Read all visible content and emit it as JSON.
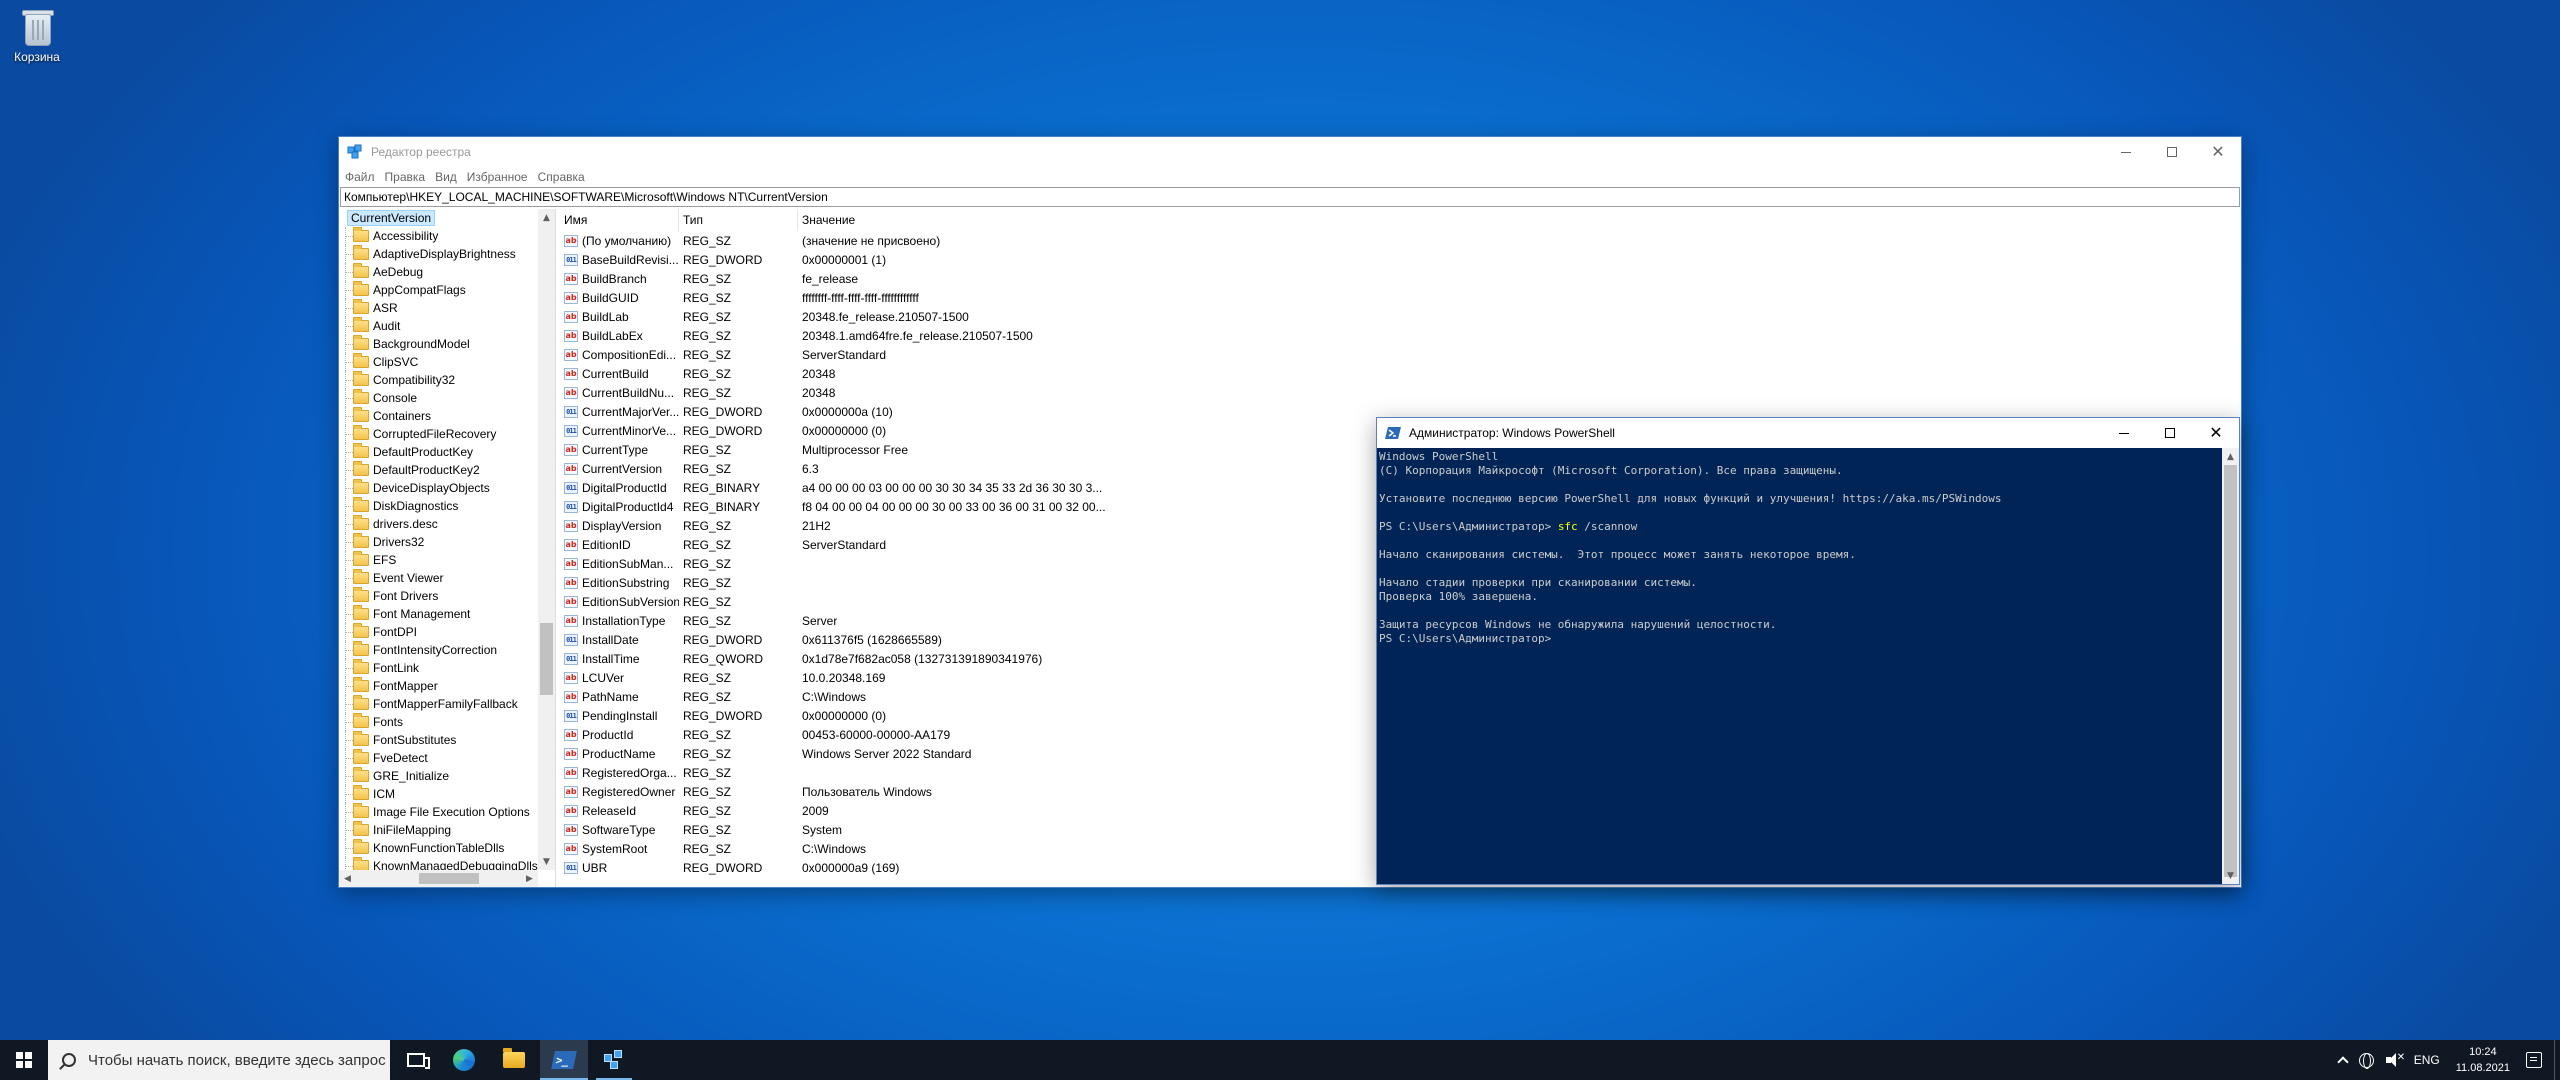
{
  "desktop": {
    "recycle_bin_label": "Корзина"
  },
  "regedit": {
    "title": "Редактор реестра",
    "menu": [
      "Файл",
      "Правка",
      "Вид",
      "Избранное",
      "Справка"
    ],
    "address": "Компьютер\\HKEY_LOCAL_MACHINE\\SOFTWARE\\Microsoft\\Windows NT\\CurrentVersion",
    "tree_selected": "CurrentVersion",
    "tree_items": [
      "Accessibility",
      "AdaptiveDisplayBrightness",
      "AeDebug",
      "AppCompatFlags",
      "ASR",
      "Audit",
      "BackgroundModel",
      "ClipSVC",
      "Compatibility32",
      "Console",
      "Containers",
      "CorruptedFileRecovery",
      "DefaultProductKey",
      "DefaultProductKey2",
      "DeviceDisplayObjects",
      "DiskDiagnostics",
      "drivers.desc",
      "Drivers32",
      "EFS",
      "Event Viewer",
      "Font Drivers",
      "Font Management",
      "FontDPI",
      "FontIntensityCorrection",
      "FontLink",
      "FontMapper",
      "FontMapperFamilyFallback",
      "Fonts",
      "FontSubstitutes",
      "FveDetect",
      "GRE_Initialize",
      "ICM",
      "Image File Execution Options",
      "IniFileMapping",
      "KnownFunctionTableDlls",
      "KnownManagedDebuggingDlls"
    ],
    "columns": {
      "name": "Имя",
      "type": "Тип",
      "value": "Значение"
    },
    "rows": [
      {
        "icon": "ab",
        "name": "(По умолчанию)",
        "type": "REG_SZ",
        "value": "(значение не присвоено)"
      },
      {
        "icon": "bin",
        "name": "BaseBuildRevisi...",
        "type": "REG_DWORD",
        "value": "0x00000001 (1)"
      },
      {
        "icon": "ab",
        "name": "BuildBranch",
        "type": "REG_SZ",
        "value": "fe_release"
      },
      {
        "icon": "ab",
        "name": "BuildGUID",
        "type": "REG_SZ",
        "value": "ffffffff-ffff-ffff-ffff-ffffffffffff"
      },
      {
        "icon": "ab",
        "name": "BuildLab",
        "type": "REG_SZ",
        "value": "20348.fe_release.210507-1500"
      },
      {
        "icon": "ab",
        "name": "BuildLabEx",
        "type": "REG_SZ",
        "value": "20348.1.amd64fre.fe_release.210507-1500"
      },
      {
        "icon": "ab",
        "name": "CompositionEdi...",
        "type": "REG_SZ",
        "value": "ServerStandard"
      },
      {
        "icon": "ab",
        "name": "CurrentBuild",
        "type": "REG_SZ",
        "value": "20348"
      },
      {
        "icon": "ab",
        "name": "CurrentBuildNu...",
        "type": "REG_SZ",
        "value": "20348"
      },
      {
        "icon": "bin",
        "name": "CurrentMajorVer...",
        "type": "REG_DWORD",
        "value": "0x0000000a (10)"
      },
      {
        "icon": "bin",
        "name": "CurrentMinorVe...",
        "type": "REG_DWORD",
        "value": "0x00000000 (0)"
      },
      {
        "icon": "ab",
        "name": "CurrentType",
        "type": "REG_SZ",
        "value": "Multiprocessor Free"
      },
      {
        "icon": "ab",
        "name": "CurrentVersion",
        "type": "REG_SZ",
        "value": "6.3"
      },
      {
        "icon": "bin",
        "name": "DigitalProductId",
        "type": "REG_BINARY",
        "value": "a4 00 00 00 03 00 00 00 30 30 34 35 33 2d 36 30 30 3..."
      },
      {
        "icon": "bin",
        "name": "DigitalProductId4",
        "type": "REG_BINARY",
        "value": "f8 04 00 00 04 00 00 00 30 00 33 00 36 00 31 00 32 00..."
      },
      {
        "icon": "ab",
        "name": "DisplayVersion",
        "type": "REG_SZ",
        "value": "21H2"
      },
      {
        "icon": "ab",
        "name": "EditionID",
        "type": "REG_SZ",
        "value": "ServerStandard"
      },
      {
        "icon": "ab",
        "name": "EditionSubMan...",
        "type": "REG_SZ",
        "value": ""
      },
      {
        "icon": "ab",
        "name": "EditionSubstring",
        "type": "REG_SZ",
        "value": ""
      },
      {
        "icon": "ab",
        "name": "EditionSubVersion",
        "type": "REG_SZ",
        "value": ""
      },
      {
        "icon": "ab",
        "name": "InstallationType",
        "type": "REG_SZ",
        "value": "Server"
      },
      {
        "icon": "bin",
        "name": "InstallDate",
        "type": "REG_DWORD",
        "value": "0x611376f5 (1628665589)"
      },
      {
        "icon": "bin",
        "name": "InstallTime",
        "type": "REG_QWORD",
        "value": "0x1d78e7f682ac058 (132731391890341976)"
      },
      {
        "icon": "ab",
        "name": "LCUVer",
        "type": "REG_SZ",
        "value": "10.0.20348.169"
      },
      {
        "icon": "ab",
        "name": "PathName",
        "type": "REG_SZ",
        "value": "C:\\Windows"
      },
      {
        "icon": "bin",
        "name": "PendingInstall",
        "type": "REG_DWORD",
        "value": "0x00000000 (0)"
      },
      {
        "icon": "ab",
        "name": "ProductId",
        "type": "REG_SZ",
        "value": "00453-60000-00000-AA179"
      },
      {
        "icon": "ab",
        "name": "ProductName",
        "type": "REG_SZ",
        "value": "Windows Server 2022 Standard"
      },
      {
        "icon": "ab",
        "name": "RegisteredOrga...",
        "type": "REG_SZ",
        "value": ""
      },
      {
        "icon": "ab",
        "name": "RegisteredOwner",
        "type": "REG_SZ",
        "value": "Пользователь Windows"
      },
      {
        "icon": "ab",
        "name": "ReleaseId",
        "type": "REG_SZ",
        "value": "2009"
      },
      {
        "icon": "ab",
        "name": "SoftwareType",
        "type": "REG_SZ",
        "value": "System"
      },
      {
        "icon": "ab",
        "name": "SystemRoot",
        "type": "REG_SZ",
        "value": "C:\\Windows"
      },
      {
        "icon": "bin",
        "name": "UBR",
        "type": "REG_DWORD",
        "value": "0x000000a9 (169)"
      }
    ]
  },
  "powershell": {
    "title": "Администратор: Windows PowerShell",
    "lines": [
      {
        "text": "Windows PowerShell"
      },
      {
        "text": "(C) Корпорация Майкрософт (Microsoft Corporation). Все права защищены."
      },
      {
        "text": ""
      },
      {
        "text": "Установите последнюю версию PowerShell для новых функций и улучшения! https://aka.ms/PSWindows"
      },
      {
        "text": ""
      },
      {
        "text": "PS C:\\Users\\Администратор> ",
        "cmd": "sfc",
        "arg": " /scannow"
      },
      {
        "text": ""
      },
      {
        "text": "Начало сканирования системы.  Этот процесс может занять некоторое время."
      },
      {
        "text": ""
      },
      {
        "text": "Начало стадии проверки при сканировании системы."
      },
      {
        "text": "Проверка 100% завершена."
      },
      {
        "text": ""
      },
      {
        "text": "Защита ресурсов Windows не обнаружила нарушений целостности."
      },
      {
        "text": "PS C:\\Users\\Администратор>"
      }
    ]
  },
  "taskbar": {
    "search_placeholder": "Чтобы начать поиск, введите здесь запрос",
    "language": "ENG",
    "time": "10:24",
    "date": "11.08.2021"
  }
}
